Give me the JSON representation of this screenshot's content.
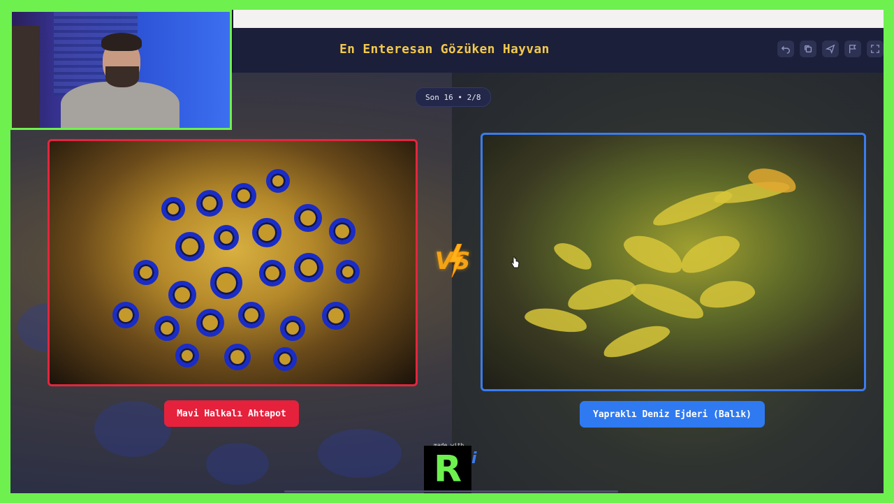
{
  "header": {
    "title": "En Enteresan Gözüken Hayvan",
    "toolbar": [
      {
        "name": "undo-icon"
      },
      {
        "name": "copy-icon"
      },
      {
        "name": "send-icon"
      },
      {
        "name": "flag-icon"
      },
      {
        "name": "fullscreen-icon"
      }
    ]
  },
  "round": {
    "label": "Son 16 • 2/8"
  },
  "matchup": {
    "left": {
      "name": "Mavi Halkalı Ahtapot",
      "accent": "#e2263e"
    },
    "right": {
      "name": "Yapraklı Deniz Ejderi (Balık)",
      "accent": "#3a7cf0"
    },
    "vs_label": "VS"
  },
  "branding": {
    "made_with": "made with",
    "logo_letter": "R",
    "logo_suffix": "i"
  },
  "colors": {
    "frame": "#6ef04f",
    "title": "#f2c94c",
    "header_bg": "#1c1f3a"
  }
}
